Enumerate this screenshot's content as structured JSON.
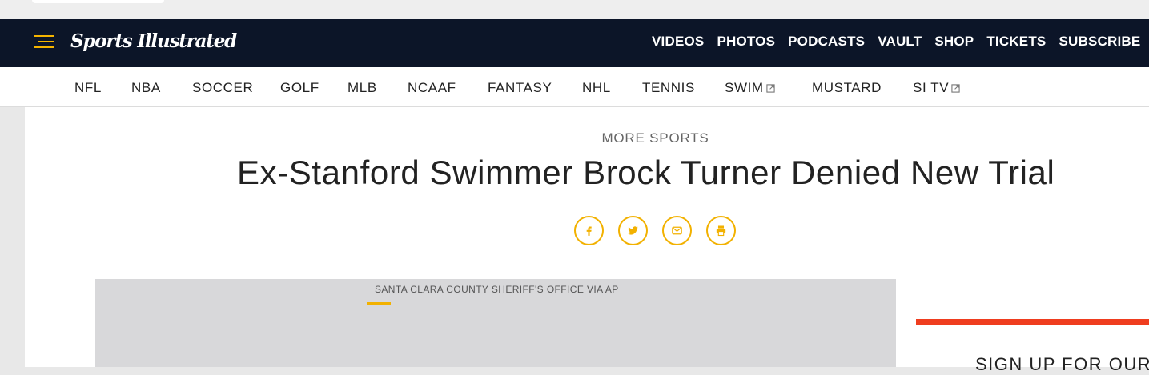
{
  "brand": {
    "logo_text": "Sports Illustrated",
    "accent_color": "#f5b400",
    "nav_bg": "#0c1528"
  },
  "main_nav": {
    "links": [
      "VIDEOS",
      "PHOTOS",
      "PODCASTS",
      "VAULT",
      "SHOP",
      "TICKETS",
      "SUBSCRIBE"
    ]
  },
  "sub_nav": {
    "items": [
      {
        "label": "NFL",
        "external": false
      },
      {
        "label": "NBA",
        "external": false
      },
      {
        "label": "SOCCER",
        "external": false
      },
      {
        "label": "GOLF",
        "external": false
      },
      {
        "label": "MLB",
        "external": false
      },
      {
        "label": "NCAAF",
        "external": false
      },
      {
        "label": "FANTASY",
        "external": false
      },
      {
        "label": "NHL",
        "external": false
      },
      {
        "label": "TENNIS",
        "external": false
      },
      {
        "label": "SWIM",
        "external": true
      },
      {
        "label": "MUSTARD",
        "external": false
      },
      {
        "label": "SI TV",
        "external": true
      }
    ]
  },
  "article": {
    "kicker": "MORE SPORTS",
    "headline": "Ex-Stanford Swimmer Brock Turner Denied New Trial",
    "share_icons": [
      "facebook-icon",
      "twitter-icon",
      "email-icon",
      "print-icon"
    ],
    "image_credit": "SANTA CLARA COUNTY SHERIFF'S OFFICE VIA AP"
  },
  "sidebar": {
    "signup_text": "SIGN UP FOR OUR",
    "accent_bar_color": "#ef3d1f"
  }
}
